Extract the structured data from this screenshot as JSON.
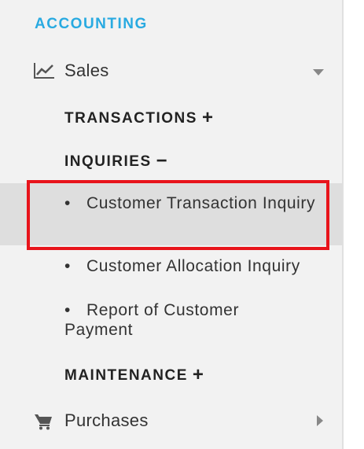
{
  "sidebar": {
    "section_title": "ACCOUNTING",
    "sales": {
      "label": "Sales",
      "icon": "line-chart-icon"
    },
    "groups": {
      "transactions": {
        "label": "TRANSACTIONS",
        "toggle": "+"
      },
      "inquiries": {
        "label": "INQUIRIES",
        "toggle": "−"
      },
      "maintenance": {
        "label": "MAINTENANCE",
        "toggle": "+"
      }
    },
    "inquiry_items": [
      {
        "bullet": "•",
        "label": "Customer Transaction Inquiry"
      },
      {
        "bullet": "•",
        "label": "Customer Allocation Inquiry"
      },
      {
        "bullet": "•",
        "label": "Report of Customer Payment"
      }
    ],
    "purchases": {
      "label": "Purchases",
      "icon": "cart-icon"
    }
  },
  "colors": {
    "accent": "#29aae1",
    "highlight_border": "#e8141b",
    "active_bg": "#dedede",
    "sidebar_bg": "#f2f2f2"
  }
}
